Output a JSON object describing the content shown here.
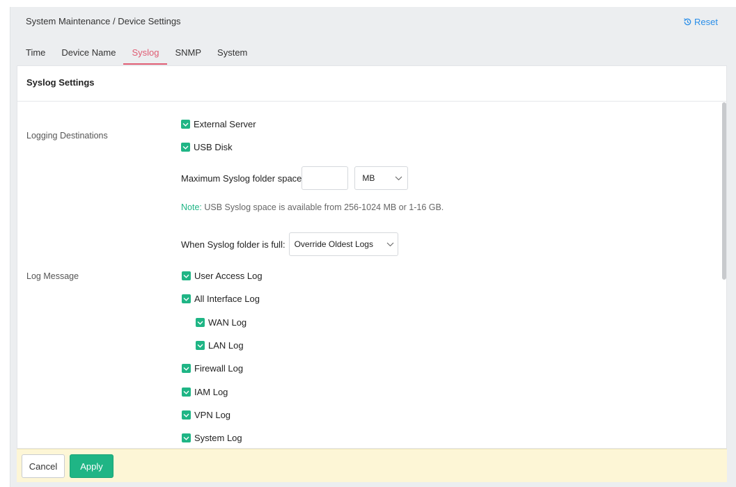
{
  "header": {
    "breadcrumb": "System Maintenance / Device Settings",
    "reset_label": "Reset"
  },
  "tabs": [
    {
      "label": "Time",
      "active": false
    },
    {
      "label": "Device Name",
      "active": false
    },
    {
      "label": "Syslog",
      "active": true
    },
    {
      "label": "SNMP",
      "active": false
    },
    {
      "label": "System",
      "active": false
    }
  ],
  "panel": {
    "title": "Syslog Settings",
    "logging_destinations": {
      "label": "Logging Destinations",
      "external_server": {
        "label": "External Server",
        "checked": true
      },
      "usb_disk": {
        "label": "USB Disk",
        "checked": true
      },
      "max_space": {
        "label": "Maximum Syslog folder space",
        "value": "",
        "unit": "MB"
      },
      "note_prefix": "Note:",
      "note_text": " USB Syslog space is available from 256-1024 MB or 1-16 GB.",
      "when_full": {
        "label": "When Syslog folder is full:",
        "value": "Override Oldest Logs"
      }
    },
    "log_message": {
      "label": "Log Message",
      "items": [
        {
          "label": "User Access Log",
          "checked": true
        },
        {
          "label": "All Interface Log",
          "checked": true
        },
        {
          "label": "WAN Log",
          "checked": true
        },
        {
          "label": "LAN Log",
          "checked": true
        },
        {
          "label": "Firewall Log",
          "checked": true
        },
        {
          "label": "IAM Log",
          "checked": true
        },
        {
          "label": "VPN Log",
          "checked": true
        },
        {
          "label": "System Log",
          "checked": true
        }
      ]
    }
  },
  "footer": {
    "cancel_label": "Cancel",
    "apply_label": "Apply"
  },
  "colors": {
    "accent_green": "#1fb585",
    "active_tab": "#e05c73",
    "link_blue": "#2a8ee8",
    "footer_bg": "#fdf6d6"
  }
}
